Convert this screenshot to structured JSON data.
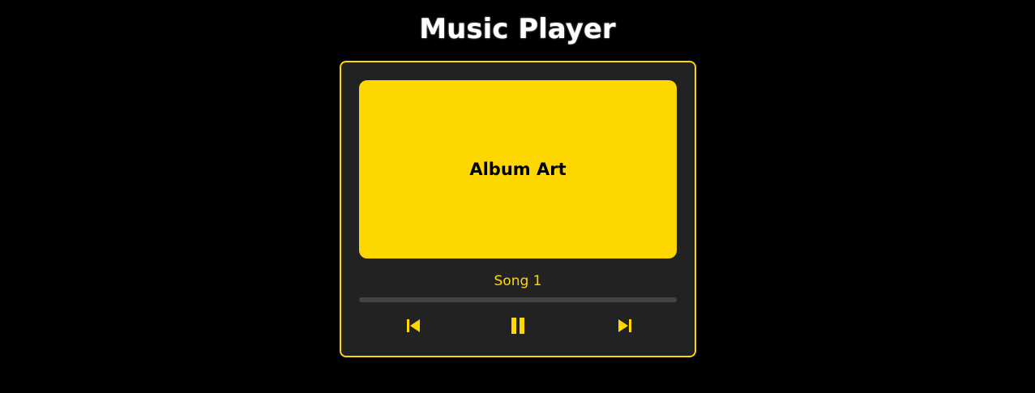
{
  "page": {
    "title": "Music Player"
  },
  "player": {
    "album_art_label": "Album Art",
    "song_title": "Song 1",
    "progress": 0,
    "controls": {
      "previous_icon": "skip-previous-icon",
      "pause_icon": "pause-icon",
      "next_icon": "skip-next-icon"
    }
  },
  "colors": {
    "background": "#000000",
    "panel": "#222222",
    "accent": "#ffd700",
    "track": "#444444",
    "title_text": "#ffffff"
  }
}
